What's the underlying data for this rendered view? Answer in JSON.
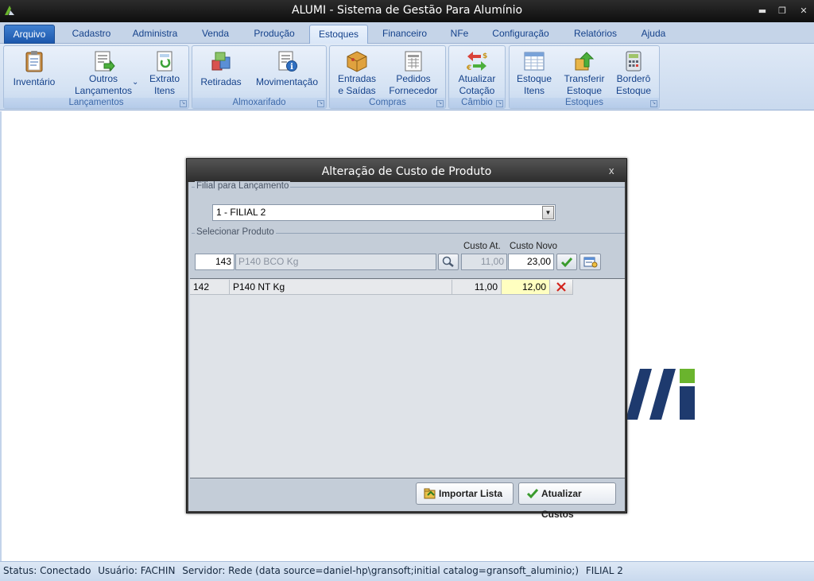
{
  "window": {
    "title": "ALUMI - Sistema de Gestão Para Alumínio",
    "minimize": "▬",
    "restore": "❐",
    "close": "✕"
  },
  "ribbon_tabs": [
    "Arquivo",
    "Cadastro",
    "Administra",
    "Venda",
    "Produção",
    "Estoques",
    "Financeiro",
    "NFe",
    "Configuração",
    "Relatórios",
    "Ajuda"
  ],
  "active_tab": "Estoques",
  "groups": {
    "lancamentos": {
      "label": "Lançamentos",
      "buttons": [
        {
          "label": [
            "Inventário"
          ],
          "icon": "clipboard-icon"
        },
        {
          "label": [
            "Outros",
            "Lançamentos"
          ],
          "icon": "document-arrow-icon",
          "dropdown": "⌄"
        },
        {
          "label": [
            "Extrato",
            "Itens"
          ],
          "icon": "statement-icon"
        }
      ]
    },
    "almoxarifado": {
      "label": "Almoxarifado",
      "buttons": [
        {
          "label": [
            "Retiradas"
          ],
          "icon": "boxes-icon"
        },
        {
          "label": [
            "Movimentação"
          ],
          "icon": "document-info-icon"
        }
      ]
    },
    "compras": {
      "label": "Compras",
      "buttons": [
        {
          "label": [
            "Entradas",
            "e Saídas"
          ],
          "icon": "package-icon"
        },
        {
          "label": [
            "Pedidos",
            "Fornecedor"
          ],
          "icon": "order-form-icon"
        }
      ]
    },
    "cambio": {
      "label": "Câmbio",
      "buttons": [
        {
          "label": [
            "Atualizar",
            "Cotação"
          ],
          "icon": "currency-exchange-icon"
        }
      ]
    },
    "estoques": {
      "label": "Estoques",
      "buttons": [
        {
          "label": [
            "Estoque",
            "Itens"
          ],
          "icon": "table-icon"
        },
        {
          "label": [
            "Transferir",
            "Estoque"
          ],
          "icon": "transfer-icon"
        },
        {
          "label": [
            "Borderô",
            "Estoque"
          ],
          "icon": "calculator-icon"
        }
      ]
    }
  },
  "dialog": {
    "title": "Alteração de Custo de Produto",
    "close": "x",
    "filial_legend": "Filial para Lançamento",
    "filial_value": "1 - FILIAL 2",
    "produto_legend": "Selecionar Produto",
    "col_custo_at": "Custo At.",
    "col_custo_novo": "Custo Novo",
    "product_code": "143",
    "product_desc": "P140 BCO Kg",
    "custo_atual": "11,00",
    "custo_novo": "23,00",
    "rows": [
      {
        "code": "142",
        "desc": "P140 NT Kg",
        "custo_at": "11,00",
        "custo_novo": "12,00"
      }
    ],
    "btn_import": "Importar Lista",
    "btn_update": "Atualizar Custos"
  },
  "status": {
    "status": "Status: Conectado",
    "user": "Usuário: FACHIN",
    "server": "Servidor: Rede (data source=daniel-hp\\gransoft;initial catalog=gransoft_aluminio;)",
    "filial": "FILIAL 2"
  },
  "colors": {
    "ribbon_text": "#15428b",
    "logo_blue": "#1e3a6e",
    "logo_green": "#6ab42d"
  }
}
